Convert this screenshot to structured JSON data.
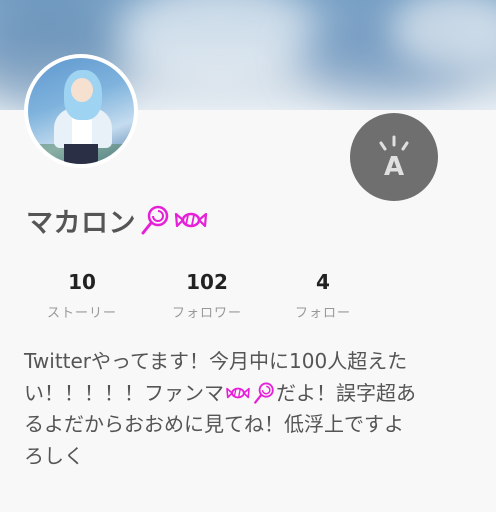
{
  "profile": {
    "name": "マカロン",
    "emoji_suffix": [
      "lollipop-icon",
      "candy-icon"
    ],
    "edit_badge_icon": "letter-a-sparkle-icon"
  },
  "stats": [
    {
      "value": "10",
      "label": "ストーリー"
    },
    {
      "value": "102",
      "label": "フォロワー"
    },
    {
      "value": "4",
      "label": "フォロー"
    }
  ],
  "bio": {
    "line1": "Twitterやってます！今月中に100人超えた",
    "line2_pre": "い！！！！！ファンマ",
    "line2_post": "だよ！誤字超あ",
    "line3": "るよだからおおめに見てね！低浮上ですよ",
    "line4": "ろしく"
  },
  "colors": {
    "accent_magenta": "#e620d8",
    "edit_badge_bg": "#6f6f6f",
    "name_text": "#555555"
  }
}
